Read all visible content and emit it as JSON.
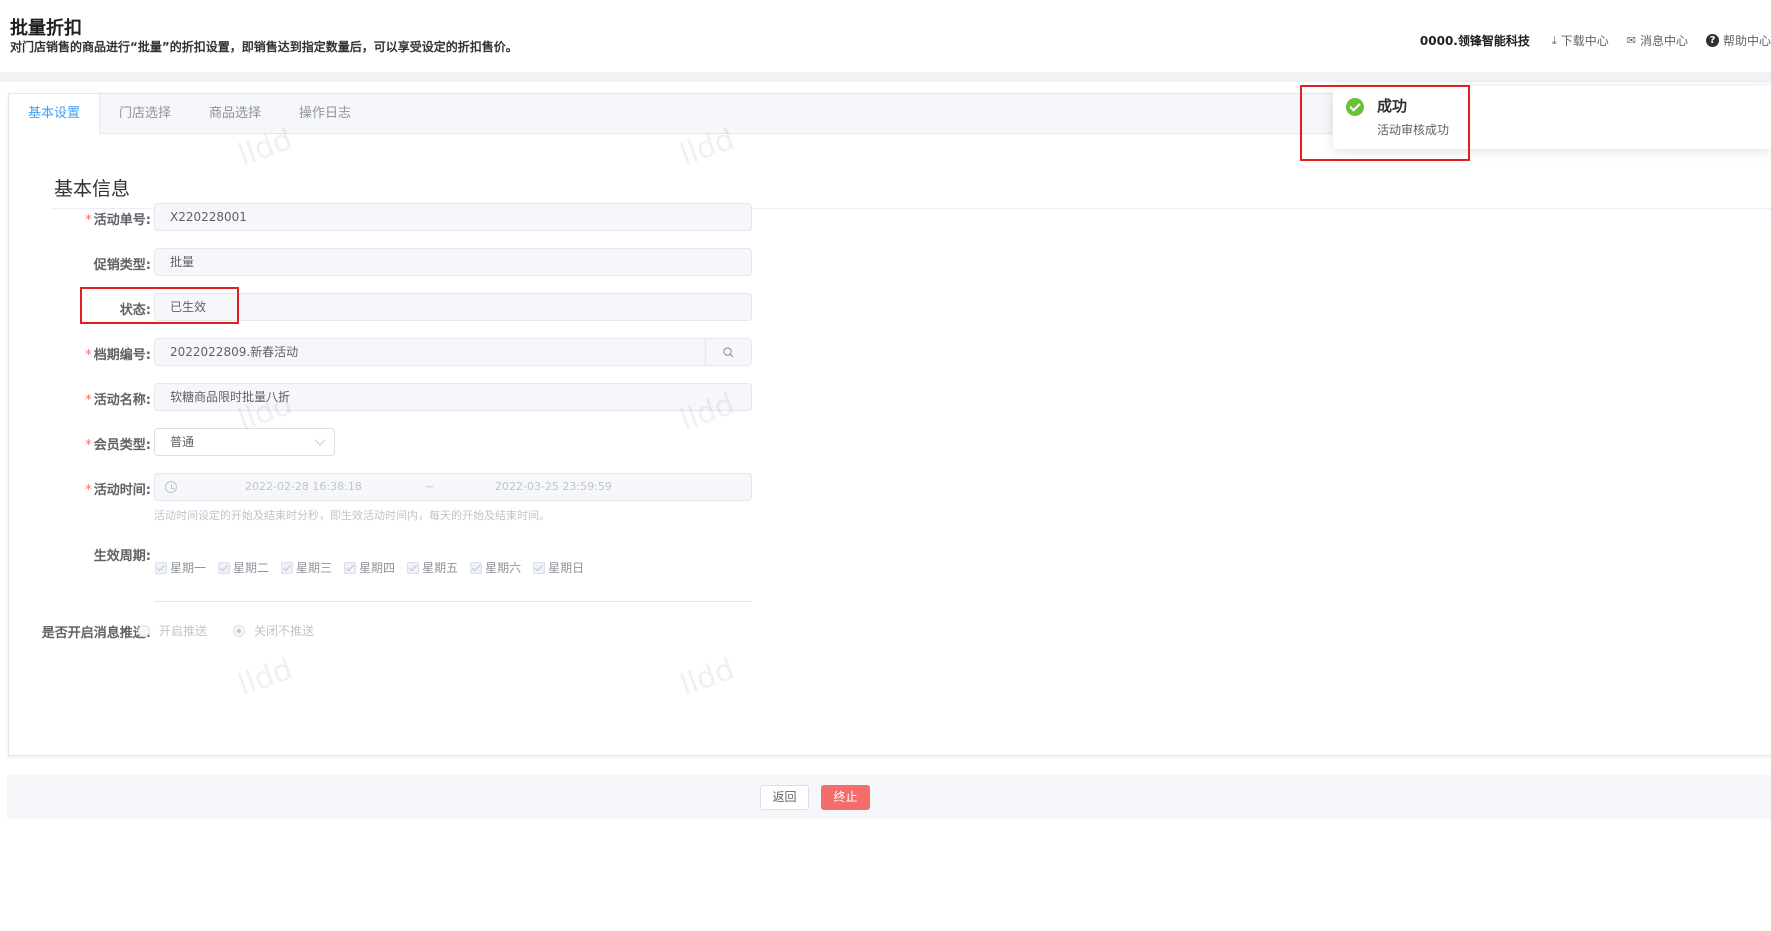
{
  "header": {
    "title": "批量折扣",
    "description": "对门店销售的商品进行“批量”的折扣设置，即销售达到指定数量后，可以享受设定的折扣售价。",
    "company": "0000.领锋智能科技",
    "links": [
      "下载中心",
      "消息中心",
      "帮助中心"
    ]
  },
  "tabs": [
    {
      "label": "基本设置",
      "active": true
    },
    {
      "label": "门店选择",
      "active": false
    },
    {
      "label": "商品选择",
      "active": false
    },
    {
      "label": "操作日志",
      "active": false
    }
  ],
  "section_title": "基本信息",
  "form": {
    "activity_no": {
      "label": "活动单号:",
      "required": true,
      "value": "X220228001"
    },
    "promo_type": {
      "label": "促销类型:",
      "required": false,
      "value": "批量"
    },
    "status": {
      "label": "状态:",
      "required": false,
      "value": "已生效"
    },
    "schedule_no": {
      "label": "档期编号:",
      "required": true,
      "value": "2022022809.新春活动"
    },
    "activity_name": {
      "label": "活动名称:",
      "required": true,
      "value": "软糖商品限时批量八折"
    },
    "member_type": {
      "label": "会员类型:",
      "required": true,
      "value": "普通"
    },
    "activity_time": {
      "label": "活动时间:",
      "required": true,
      "start": "2022-02-28 16:38:18",
      "separator": "~",
      "end": "2022-03-25 23:59:59",
      "hint": "活动时间设定的开始及结束时分秒，即生效活动时间内，每天的开始及结束时间。"
    },
    "effective_cycle": {
      "label": "生效周期:",
      "days": [
        "星期一",
        "星期二",
        "星期三",
        "星期四",
        "星期五",
        "星期六",
        "星期日"
      ]
    },
    "push": {
      "label": "是否开启消息推送:",
      "options": [
        "开启推送",
        "关闭不推送"
      ],
      "selected": "关闭不推送"
    }
  },
  "watermark": "lldd",
  "footer": {
    "back": "返回",
    "stop": "终止"
  },
  "toast": {
    "title": "成功",
    "message": "活动审核成功",
    "type": "success"
  },
  "colors": {
    "primary": "#409eff",
    "danger": "#f56c6c",
    "success": "#67c23a",
    "highlight": "#e02020"
  }
}
